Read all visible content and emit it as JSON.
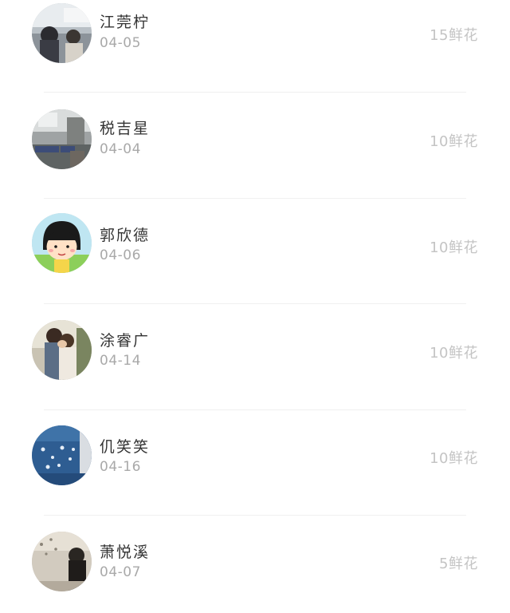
{
  "records": [
    {
      "name": "江莞柠",
      "date": "04-05",
      "amount": "15鲜花",
      "avatar_icon": "photo-avatar-icon"
    },
    {
      "name": "税吉星",
      "date": "04-04",
      "amount": "10鲜花",
      "avatar_icon": "photo-avatar-icon"
    },
    {
      "name": "郭欣德",
      "date": "04-06",
      "amount": "10鲜花",
      "avatar_icon": "cartoon-girl-avatar-icon"
    },
    {
      "name": "涂睿广",
      "date": "04-14",
      "amount": "10鲜花",
      "avatar_icon": "couple-photo-avatar-icon"
    },
    {
      "name": "仉笑笑",
      "date": "04-16",
      "amount": "10鲜花",
      "avatar_icon": "blue-fabric-avatar-icon"
    },
    {
      "name": "萧悦溪",
      "date": "04-07",
      "amount": "5鲜花",
      "avatar_icon": "photo-avatar-icon"
    }
  ]
}
